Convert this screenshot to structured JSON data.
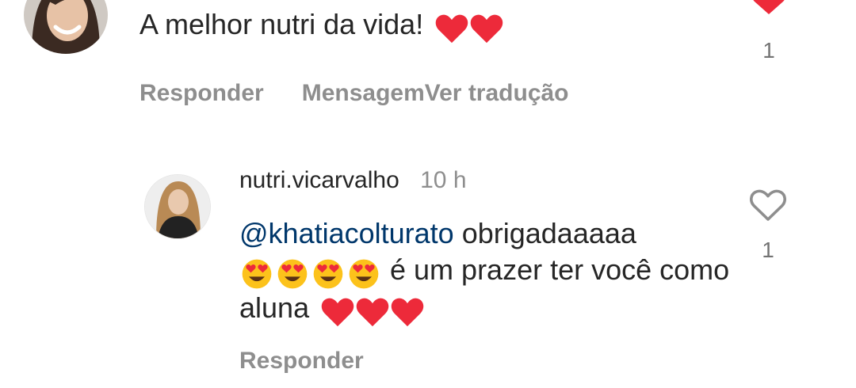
{
  "comments": [
    {
      "text": "A melhor nutri da vida!",
      "heart_emoji_count": 2,
      "likes": "1",
      "liked": true,
      "actions": {
        "reply": "Responder",
        "message": "Mensagem",
        "translate": "Ver tradução"
      }
    }
  ],
  "reply": {
    "username": "nutri.vicarvalho",
    "time": "10 h",
    "mention": "@khatiacolturato",
    "text_part1": "obrigadaaaaa",
    "heart_eyes_emoji_count": 4,
    "text_part2": "é um prazer ter você como aluna",
    "heart_emoji_count": 3,
    "likes": "1",
    "liked": false,
    "actions": {
      "reply": "Responder"
    }
  },
  "colors": {
    "heart_red": "#ed2a3a",
    "mention_blue": "#00376b",
    "muted_gray": "#8e8e8e",
    "text": "#262626"
  }
}
